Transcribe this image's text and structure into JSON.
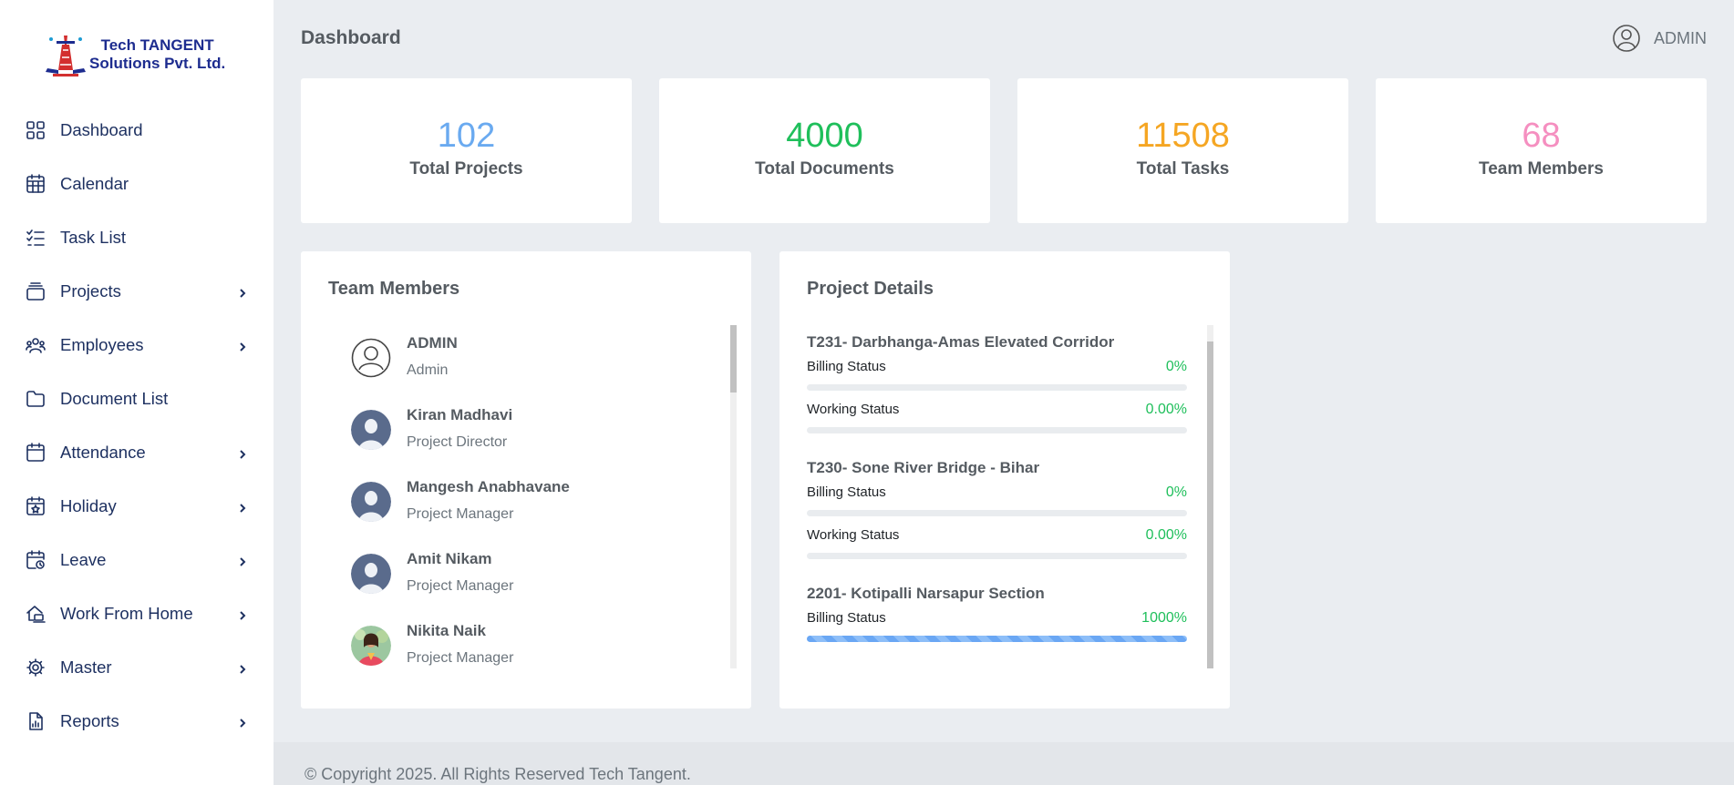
{
  "brand": {
    "line1": "Tech TANGENT",
    "line2": "Solutions Pvt. Ltd."
  },
  "sidebar": {
    "items": [
      {
        "label": "Dashboard",
        "icon": "dashboard-grid-icon"
      },
      {
        "label": "Calendar",
        "icon": "calendar-grid-icon"
      },
      {
        "label": "Task List",
        "icon": "task-list-icon"
      },
      {
        "label": "Projects",
        "icon": "projects-stack-icon"
      },
      {
        "label": "Employees",
        "icon": "employees-users-icon"
      },
      {
        "label": "Document List",
        "icon": "folder-icon"
      },
      {
        "label": "Attendance",
        "icon": "calendar-icon"
      },
      {
        "label": "Holiday",
        "icon": "calendar-star-icon"
      },
      {
        "label": "Leave",
        "icon": "calendar-clock-icon"
      },
      {
        "label": "Work From Home",
        "icon": "home-laptop-icon"
      },
      {
        "label": "Master",
        "icon": "gear-icon"
      },
      {
        "label": "Reports",
        "icon": "report-file-icon"
      }
    ]
  },
  "header": {
    "title": "Dashboard",
    "user": "ADMIN"
  },
  "stats": [
    {
      "value": "102",
      "label": "Total Projects",
      "color": "#6aaaf0"
    },
    {
      "value": "4000",
      "label": "Total Documents",
      "color": "#1fbf5b"
    },
    {
      "value": "11508",
      "label": "Total Tasks",
      "color": "#f5a623"
    },
    {
      "value": "68",
      "label": "Team Members",
      "color": "#f58fc0"
    }
  ],
  "team": {
    "title": "Team Members",
    "members": [
      {
        "name": "ADMIN",
        "role": "Admin"
      },
      {
        "name": "Kiran Madhavi",
        "role": "Project Director"
      },
      {
        "name": "Mangesh Anabhavane",
        "role": "Project Manager"
      },
      {
        "name": "Amit Nikam",
        "role": "Project Manager"
      },
      {
        "name": "Nikita Naik",
        "role": "Project Manager"
      }
    ]
  },
  "projects": {
    "title": "Project Details",
    "items": [
      {
        "name": "T231- Darbhanga-Amas Elevated Corridor",
        "billing_label": "Billing Status",
        "billing": "0%",
        "billing_fill": 0,
        "working_label": "Working Status",
        "working": "0.00%",
        "working_fill": 0
      },
      {
        "name": "T230- Sone River Bridge - Bihar",
        "billing_label": "Billing Status",
        "billing": "0%",
        "billing_fill": 0,
        "working_label": "Working Status",
        "working": "0.00%",
        "working_fill": 0
      },
      {
        "name": "2201- Kotipalli Narsapur Section",
        "billing_label": "Billing Status",
        "billing": "1000%",
        "billing_fill": 100
      }
    ]
  },
  "footer": {
    "text": "© Copyright 2025. All Rights Reserved Tech Tangent."
  }
}
